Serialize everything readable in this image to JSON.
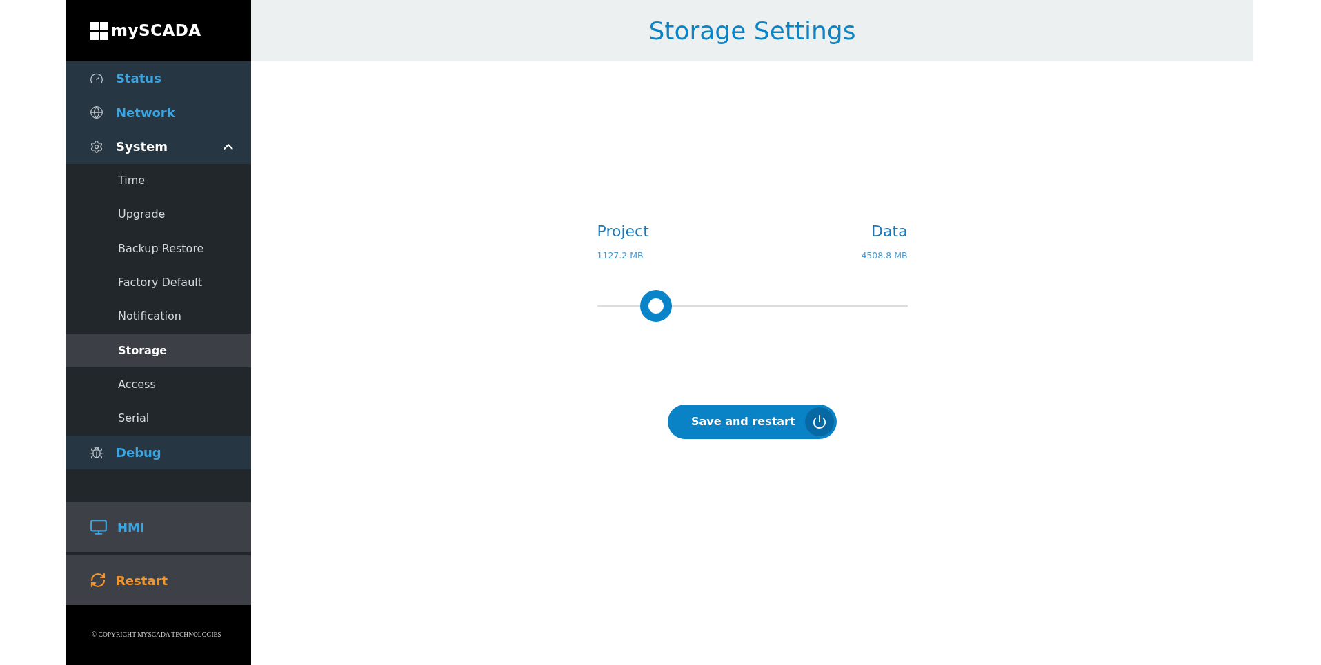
{
  "sidebar": {
    "logo": "mySCADA",
    "items": [
      {
        "label": "Status",
        "kind": "gauge",
        "selected": false
      },
      {
        "label": "Network",
        "kind": "globe",
        "selected": false
      },
      {
        "label": "System",
        "kind": "gear",
        "selected": true,
        "expanded": true,
        "children": [
          {
            "label": "Time",
            "selected": false
          },
          {
            "label": "Upgrade",
            "selected": false
          },
          {
            "label": "Backup Restore",
            "selected": false
          },
          {
            "label": "Factory Default",
            "selected": false
          },
          {
            "label": "Notification",
            "selected": false
          },
          {
            "label": "Storage",
            "selected": true
          },
          {
            "label": "Access",
            "selected": false
          },
          {
            "label": "Serial",
            "selected": false
          }
        ]
      },
      {
        "label": "Debug",
        "kind": "bug",
        "selected": false
      }
    ],
    "actions": [
      {
        "label": "HMI",
        "kind": "hmi"
      },
      {
        "label": "Restart",
        "kind": "restart"
      }
    ],
    "copyright": "© COPYRIGHT MYSCADA TECHNOLOGIES"
  },
  "header": {
    "title": "Storage Settings"
  },
  "storage": {
    "left_label": "Project",
    "left_value": "1127.2 MB",
    "right_label": "Data",
    "right_value": "4508.8 MB",
    "level": 0.19
  },
  "save_button": {
    "label": "Save and restart"
  }
}
